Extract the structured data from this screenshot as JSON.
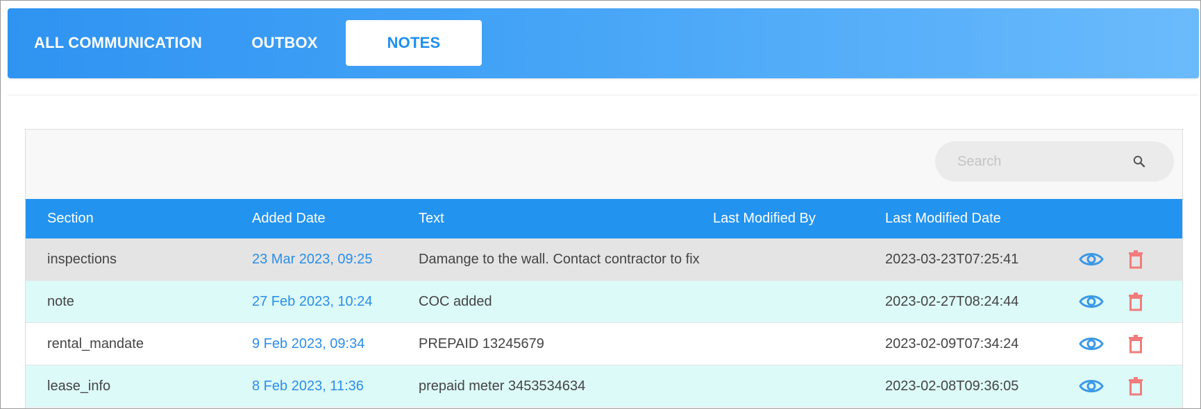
{
  "tabs": [
    {
      "label": "ALL COMMUNICATION",
      "active": false
    },
    {
      "label": "OUTBOX",
      "active": false
    },
    {
      "label": "NOTES",
      "active": true
    }
  ],
  "search": {
    "placeholder": "Search",
    "value": ""
  },
  "table": {
    "columns": [
      "Section",
      "Added Date",
      "Text",
      "Last Modified By",
      "Last Modified Date"
    ],
    "rows": [
      {
        "section": "inspections",
        "added_date": "23 Mar 2023, 09:25",
        "text": "Damange to the wall. Contact contractor to fix",
        "last_modified_by": "",
        "last_modified_date": "2023-03-23T07:25:41"
      },
      {
        "section": "note",
        "added_date": "27 Feb 2023, 10:24",
        "text": "COC added",
        "last_modified_by": "",
        "last_modified_date": "2023-02-27T08:24:44"
      },
      {
        "section": "rental_mandate",
        "added_date": "9 Feb 2023, 09:34",
        "text": "PREPAID 13245679",
        "last_modified_by": "",
        "last_modified_date": "2023-02-09T07:34:24"
      },
      {
        "section": "lease_info",
        "added_date": "8 Feb 2023, 11:36",
        "text": "prepaid meter 3453534634",
        "last_modified_by": "",
        "last_modified_date": "2023-02-08T09:36:05"
      }
    ],
    "row_actions": [
      "eye-icon",
      "trash-icon"
    ]
  },
  "colors": {
    "header_gradient_start": "#2f93f1",
    "header_gradient_end": "#6bbbfc",
    "table_header": "#2393f0",
    "date_link": "#2b8ee8",
    "view_icon": "#3a98e6",
    "delete_icon": "#f07c7c",
    "row_highlight": "#e4e4e4",
    "row_alt": "#dcfaf8"
  }
}
